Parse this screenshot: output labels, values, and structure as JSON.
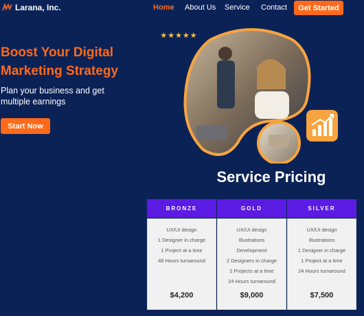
{
  "header": {
    "logo_text": "Larana, Inc.",
    "nav": [
      "Home",
      "About Us",
      "Service",
      "Contact"
    ],
    "cta": "Get Started"
  },
  "hero": {
    "title_line1": "Boost Your Digital",
    "title_line2": "Marketing Strategy",
    "subtitle_line1": "Plan your business and get",
    "subtitle_line2": "multiple earnings",
    "button": "Start Now",
    "rating": "★★★★★"
  },
  "pricing": {
    "title": "Service Pricing",
    "plans": [
      {
        "name": "BRONZE",
        "features": [
          "UX/UI design",
          "1 Designer in charge",
          "1 Project at a time",
          "48 Hours turnaround"
        ],
        "price": "$4,200"
      },
      {
        "name": "GOLD",
        "features": [
          "UX/UI design",
          "Illustrations",
          "Development",
          "2 Designers in charge",
          "2 Projects at a time",
          "24 Hours turnaround"
        ],
        "price": "$9,000"
      },
      {
        "name": "SILVER",
        "features": [
          "UX/UI design",
          "Illustrations",
          "1 Designer in charge",
          "1 Project at a time",
          "24 Hours turnaround"
        ],
        "price": "$7,500"
      }
    ]
  },
  "colors": {
    "background": "#0b2257",
    "accent": "#ff6a1a",
    "plan_header": "#5b1be3",
    "badge": "#f7a440"
  },
  "icons": [
    "logo-icon",
    "star-icon",
    "bar-chart-icon"
  ]
}
